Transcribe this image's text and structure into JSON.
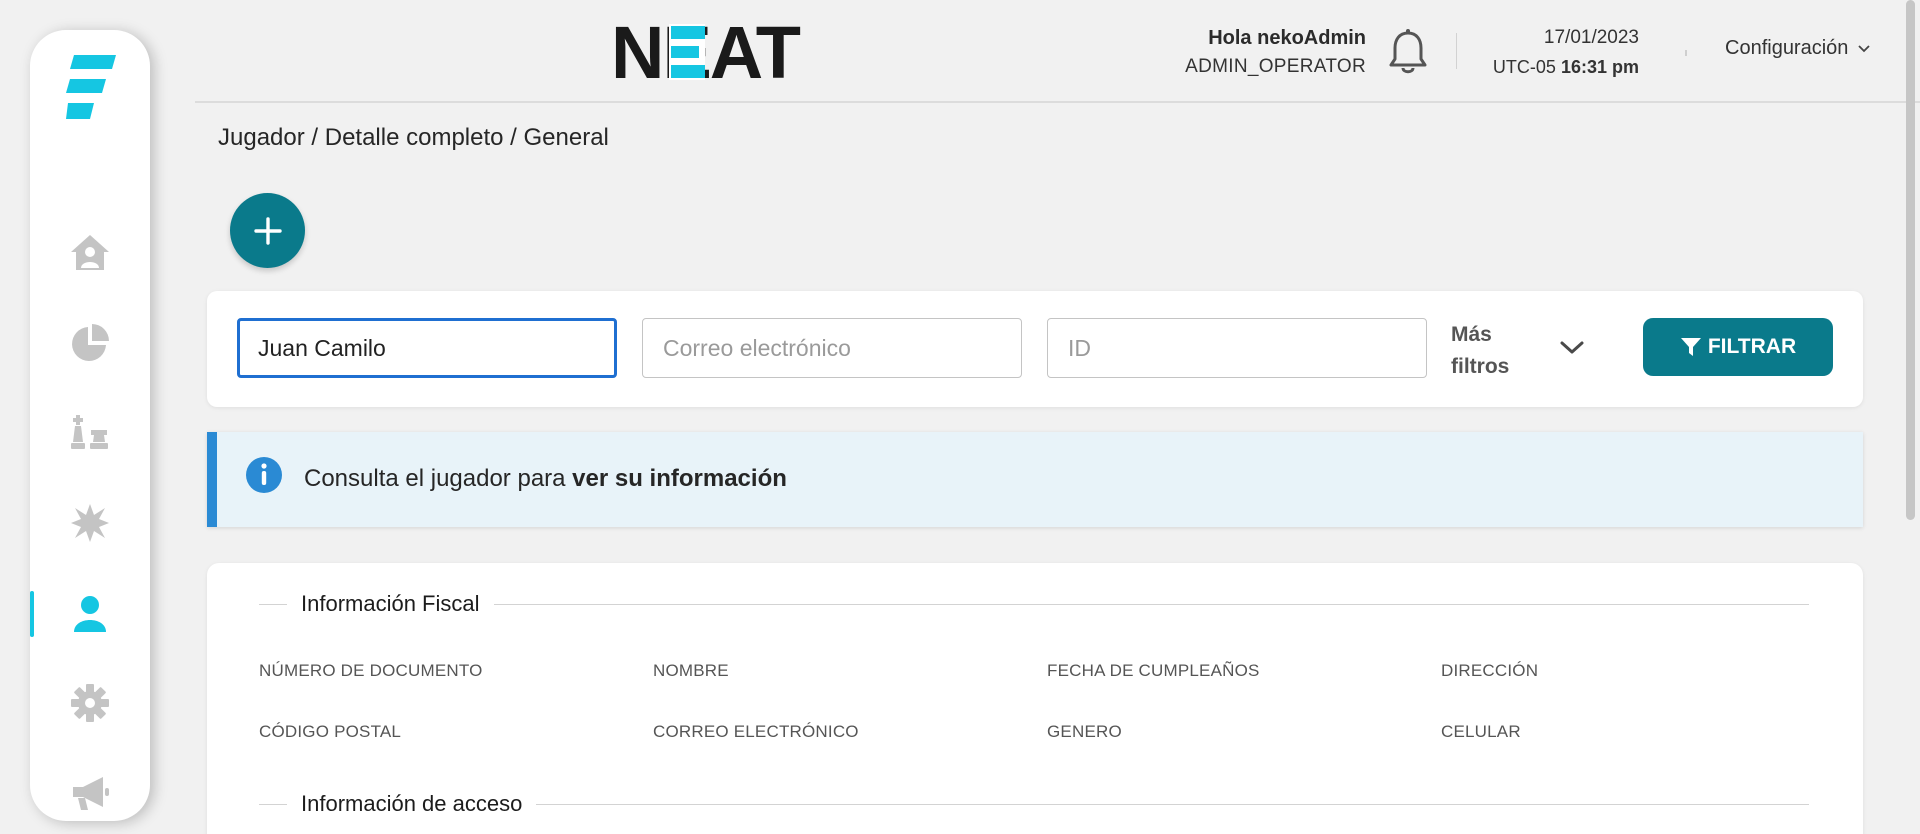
{
  "colors": {
    "teal": "#0a7a8b",
    "cyan_accent": "#15c6e2",
    "info_blue": "#2a8ad4",
    "focus_blue": "#1f6fd1"
  },
  "sidebar": {
    "items": [
      {
        "name": "home",
        "icon": "home-user-icon",
        "active": false
      },
      {
        "name": "reports",
        "icon": "pie-chart-icon",
        "active": false
      },
      {
        "name": "games",
        "icon": "chess-icon",
        "active": false
      },
      {
        "name": "promotions",
        "icon": "starburst-icon",
        "active": false
      },
      {
        "name": "players",
        "icon": "user-icon",
        "active": true
      },
      {
        "name": "settings",
        "icon": "gear-icon",
        "active": false
      },
      {
        "name": "campaigns",
        "icon": "megaphone-icon",
        "active": false
      }
    ]
  },
  "header": {
    "brand": "NEAT",
    "greeting": "Hola nekoAdmin",
    "role": "ADMIN_OPERATOR",
    "date": "17/01/2023",
    "timezone": "UTC-05",
    "time": "16:31 pm",
    "config_label": "Configuración"
  },
  "breadcrumb": "Jugador / Detalle completo / General",
  "filters": {
    "name_value": "Juan Camilo",
    "email_placeholder": "Correo electrónico",
    "id_placeholder": "ID",
    "more_line1": "Más",
    "more_line2": "filtros",
    "button_label": "FILTRAR"
  },
  "info_banner": {
    "text": "Consulta el jugador para ",
    "bold": "ver su información"
  },
  "details": {
    "fiscal_title": "Información Fiscal",
    "fiscal_fields": [
      "NÚMERO DE DOCUMENTO",
      "NOMBRE",
      "FECHA DE CUMPLEAÑOS",
      "DIRECCIÓN",
      "CÓDIGO POSTAL",
      "CORREO ELECTRÓNICO",
      "GENERO",
      "CELULAR"
    ],
    "access_title": "Información de acceso"
  }
}
